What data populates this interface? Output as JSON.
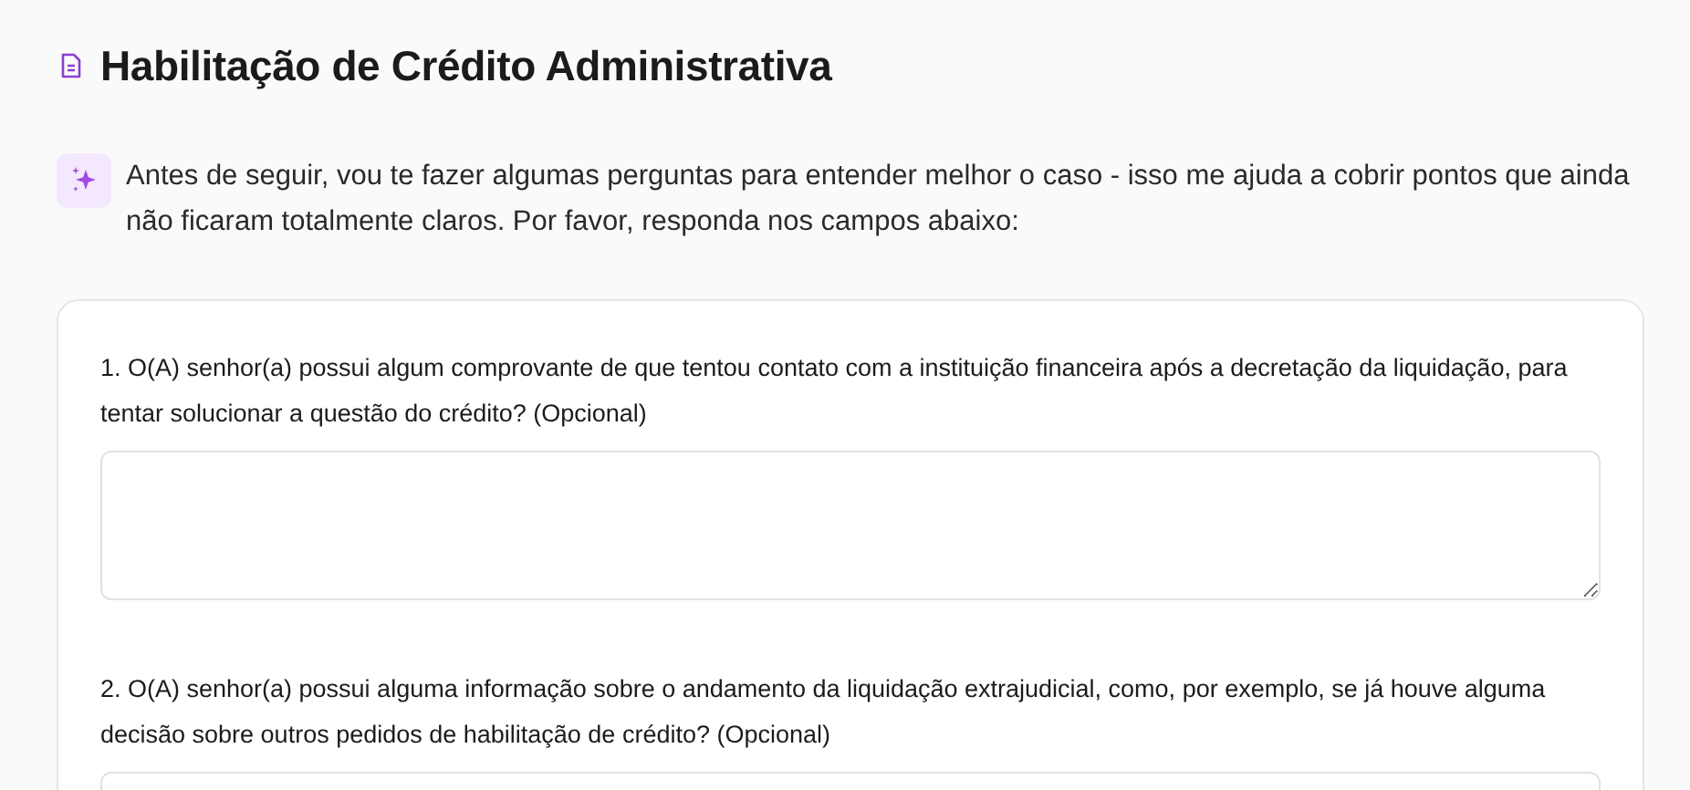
{
  "title": "Habilitação de Crédito Administrativa",
  "intro": "Antes de seguir, vou te fazer algumas perguntas para entender melhor o caso - isso me ajuda a cobrir pontos que ainda não ficaram totalmente claros. Por favor, responda nos campos abaixo:",
  "questions": [
    {
      "label": "1. O(A) senhor(a) possui algum comprovante de que tentou contato com a instituição financeira após a decretação da liquidação, para tentar solucionar a questão do crédito? (Opcional)"
    },
    {
      "label": "2. O(A) senhor(a) possui alguma informação sobre o andamento da liquidação extrajudicial, como, por exemplo, se já houve alguma decisão sobre outros pedidos de habilitação de crédito? (Opcional)"
    }
  ]
}
